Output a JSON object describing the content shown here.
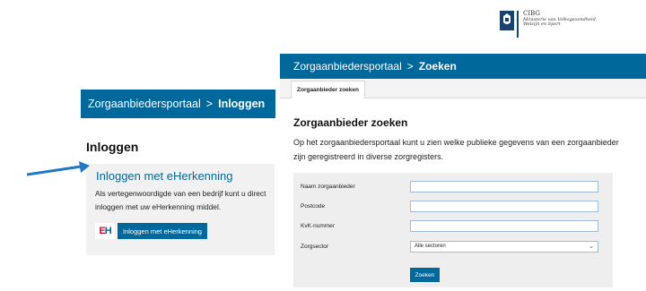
{
  "logo": {
    "org": "CIBG",
    "ministry_line1": "Ministerie van Volksgezondheid,",
    "ministry_line2": "Welzijn en Sport"
  },
  "search_window": {
    "breadcrumb_root": "Zorgaanbiedersportaal",
    "breadcrumb_sep": ">",
    "breadcrumb_current": "Zoeken",
    "tab_label": "Zorgaanbieder zoeken",
    "title": "Zorgaanbieder zoeken",
    "description": "Op het zorgaanbiedersportaal kunt u zien welke publieke gegevens van een zorgaanbieder zijn geregistreerd in diverse zorgregisters.",
    "form": {
      "fields": [
        {
          "label": "Naam zorgaanbieder",
          "value": ""
        },
        {
          "label": "Postcode",
          "value": ""
        },
        {
          "label": "KvK-nummer",
          "value": ""
        }
      ],
      "sector_label": "Zorgsector",
      "sector_value": "Alle sectoren",
      "submit_label": "Zoeken"
    }
  },
  "login_window": {
    "breadcrumb_root": "Zorgaanbiedersportaal",
    "breadcrumb_sep": ">",
    "breadcrumb_current": "Inloggen",
    "title": "Inloggen",
    "link_label": "Inloggen met eHerkenning",
    "description": "Als vertegenwoordigde van een bedrijf kunt u direct inloggen met uw eHerkenning middel.",
    "eh_logo_e": "E",
    "eh_logo_h": "H",
    "button_label": "Inloggen met eHerkenning"
  },
  "colors": {
    "brand_blue": "#01689b",
    "arrow_blue": "#1f77c8",
    "eh_red": "#e4003a"
  }
}
